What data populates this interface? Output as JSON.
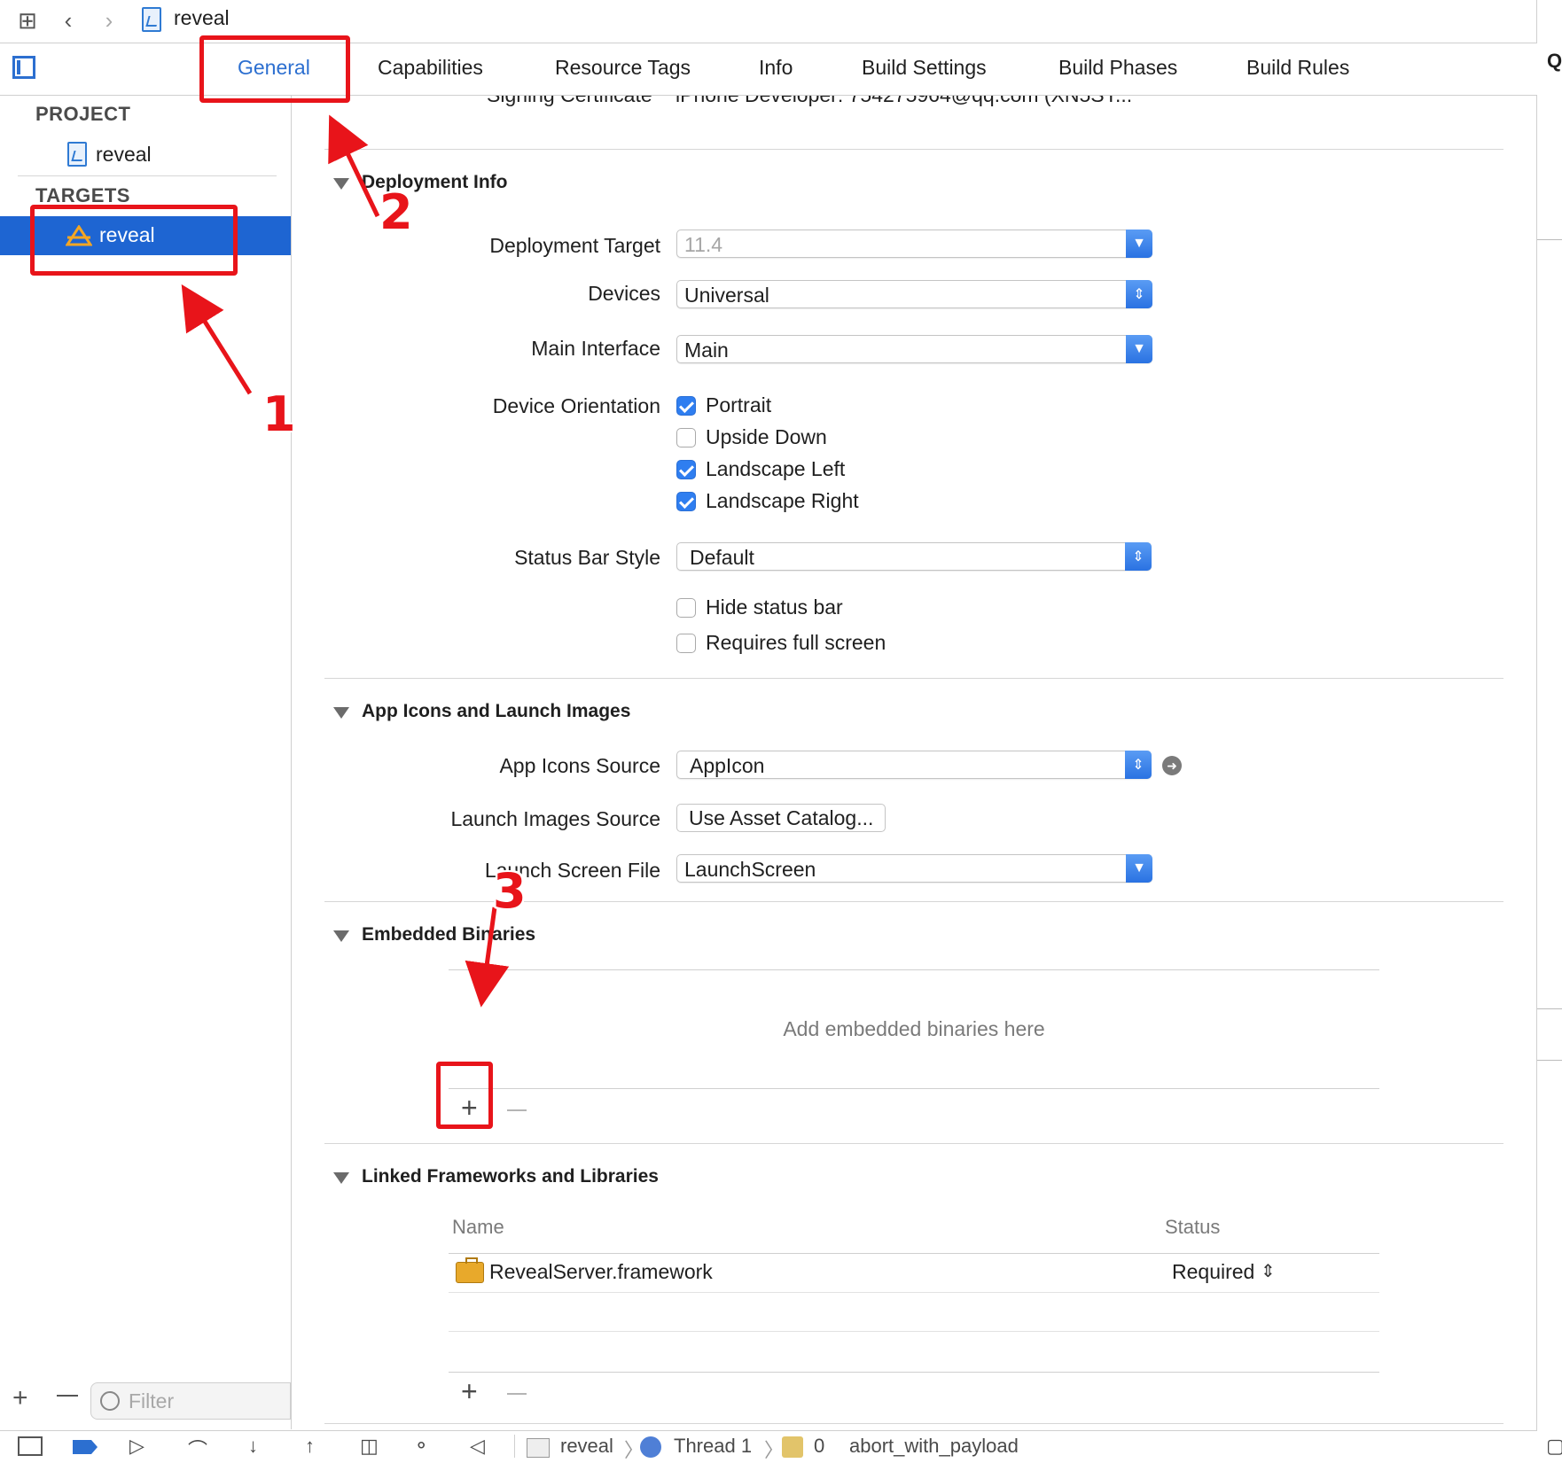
{
  "toolbar": {
    "title": "reveal"
  },
  "tabs": [
    "General",
    "Capabilities",
    "Resource Tags",
    "Info",
    "Build Settings",
    "Build Phases",
    "Build Rules"
  ],
  "right_edge_text": "Q",
  "sidebar": {
    "project_header": "PROJECT",
    "project_item": "reveal",
    "targets_header": "TARGETS",
    "target_item": "reveal",
    "filter_placeholder": "Filter"
  },
  "signing": {
    "label": "Signing Certificate",
    "value": "iPhone Developer: 754275964@qq.com (XN5SY..."
  },
  "deployment": {
    "title": "Deployment Info",
    "target_label": "Deployment Target",
    "target_value": "11.4",
    "devices_label": "Devices",
    "devices_value": "Universal",
    "main_interface_label": "Main Interface",
    "main_interface_value": "Main",
    "orientation_label": "Device Orientation",
    "orientations": [
      {
        "label": "Portrait",
        "checked": true
      },
      {
        "label": "Upside Down",
        "checked": false
      },
      {
        "label": "Landscape Left",
        "checked": true
      },
      {
        "label": "Landscape Right",
        "checked": true
      }
    ],
    "status_bar_label": "Status Bar Style",
    "status_bar_value": "Default",
    "hide_status_bar": "Hide status bar",
    "requires_full_screen": "Requires full screen"
  },
  "app_icons": {
    "title": "App Icons and Launch Images",
    "icons_source_label": "App Icons Source",
    "icons_source_value": "AppIcon",
    "launch_images_label": "Launch Images Source",
    "launch_images_button": "Use Asset Catalog...",
    "launch_screen_label": "Launch Screen File",
    "launch_screen_value": "LaunchScreen"
  },
  "embedded": {
    "title": "Embedded Binaries",
    "empty_text": "Add embedded binaries here"
  },
  "linked": {
    "title": "Linked Frameworks and Libraries",
    "col_name": "Name",
    "col_status": "Status",
    "rows": [
      {
        "name": "RevealServer.framework",
        "status": "Required"
      }
    ]
  },
  "annotations": {
    "n1": "1",
    "n2": "2",
    "n3": "3"
  },
  "debug_bar": {
    "scheme": "reveal",
    "thread": "Thread 1",
    "frame_no": "0",
    "frame": "abort_with_payload"
  },
  "colors": {
    "accent": "#2c6fd0",
    "selection": "#1e65d2",
    "annotation": "#e8141a"
  }
}
